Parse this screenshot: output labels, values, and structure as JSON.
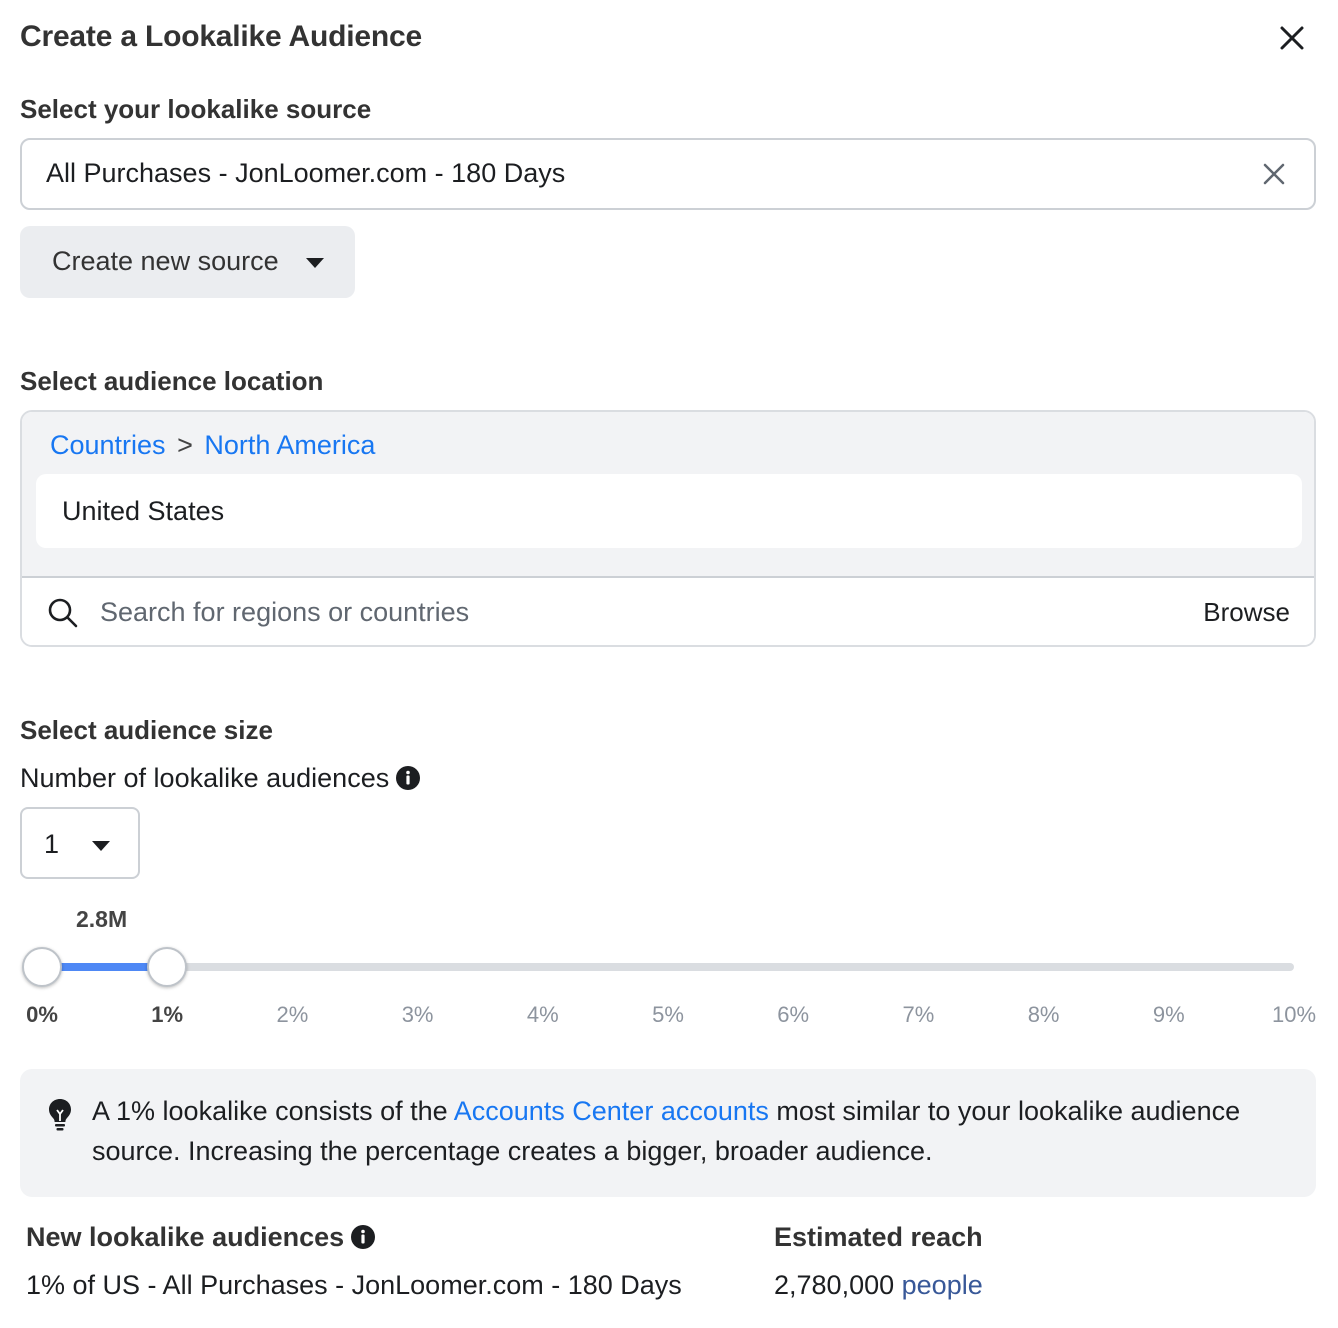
{
  "dialog": {
    "title": "Create a Lookalike Audience",
    "close_icon": "close-icon"
  },
  "source": {
    "label": "Select your lookalike source",
    "value": "All Purchases - JonLoomer.com - 180 Days",
    "clear_icon": "close-icon",
    "create_new_label": "Create new source"
  },
  "location": {
    "label": "Select audience location",
    "breadcrumb": [
      "Countries",
      ">",
      "North America"
    ],
    "selected": [
      "United States"
    ],
    "search_placeholder": "Search for regions or countries",
    "browse_label": "Browse"
  },
  "size": {
    "label": "Select audience size",
    "number_label": "Number of lookalike audiences",
    "number_value": "1",
    "slider_value_label": "2.8M",
    "slider_range_percent": [
      0,
      1
    ],
    "ticks": [
      "0%",
      "1%",
      "2%",
      "3%",
      "4%",
      "5%",
      "6%",
      "7%",
      "8%",
      "9%",
      "10%"
    ]
  },
  "tip": {
    "text_before": "A 1% lookalike consists of the ",
    "link": "Accounts Center accounts",
    "text_after": " most similar to your lookalike audience source. Increasing the percentage creates a bigger, broader audience."
  },
  "summary": {
    "new_label": "New lookalike audiences",
    "new_value": "1% of US - All Purchases - JonLoomer.com - 180 Days",
    "reach_label": "Estimated reach",
    "reach_value": "2,780,000",
    "reach_link": "people"
  },
  "colors": {
    "accent": "#1877f2",
    "slider_fill": "#4e88f5",
    "panel_bg": "#f2f3f5"
  }
}
